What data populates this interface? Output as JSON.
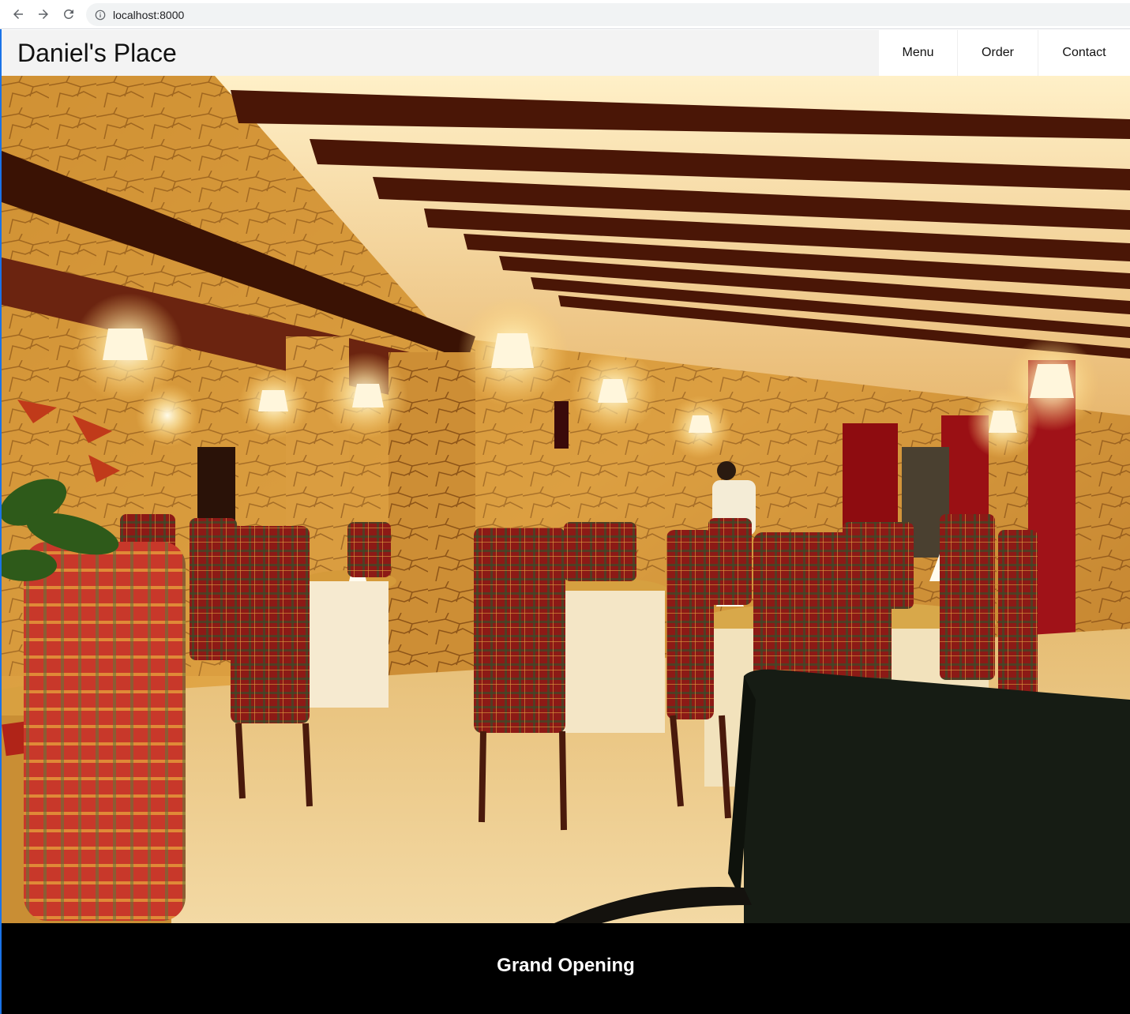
{
  "browser": {
    "url": "localhost:8000"
  },
  "site": {
    "brand": "Daniel's Place",
    "nav": [
      {
        "label": "Menu"
      },
      {
        "label": "Order"
      },
      {
        "label": "Contact"
      }
    ]
  },
  "hero": {
    "description_icon": "restaurant-interior-photo"
  },
  "banner": {
    "title": "Grand Opening"
  },
  "colors": {
    "header_bg": "#f3f3f3",
    "banner_bg": "#000000",
    "banner_text": "#ffffff",
    "accent_edge": "#1a73e8"
  }
}
